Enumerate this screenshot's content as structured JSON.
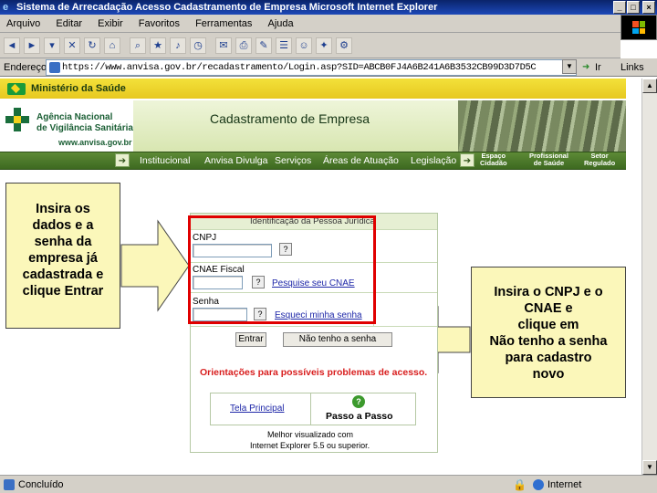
{
  "window": {
    "title": "Sistema de Arrecadação  Acesso  Cadastramento de Empresa  Microsoft Internet Explorer"
  },
  "menu": [
    "Arquivo",
    "Editar",
    "Exibir",
    "Favoritos",
    "Ferramentas",
    "Ajuda"
  ],
  "address": {
    "label": "Endereço",
    "url": "https://www.anvisa.gov.br/recadastramento/Login.asp?SID=ABCB0FJ4A6B241A6B3532CB99D3D7D5C",
    "go": "Ir",
    "links": "Links"
  },
  "header": {
    "ministry": "Ministério da Saúde",
    "agency_line1": "Agência Nacional",
    "agency_line2": "de Vigilância Sanitária",
    "agency_url": "www.anvisa.gov.br",
    "title": "Cadastramento de Empresa"
  },
  "nav": {
    "items": [
      "Institucional",
      "Anvisa Divulga",
      "Serviços",
      "Áreas de Atuação",
      "Legislação"
    ],
    "small": [
      {
        "line1": "Espaço",
        "line2": "Cidadão"
      },
      {
        "line1": "Profissional",
        "line2": "de Saúde"
      },
      {
        "line1": "Setor",
        "line2": "Regulado"
      }
    ]
  },
  "callouts": {
    "left": [
      "Insira os",
      "dados e a",
      "senha da",
      "empresa  já",
      "cadastrada e",
      "clique Entrar"
    ],
    "right": [
      "Insira o CNPJ e o",
      "CNAE e",
      "clique em",
      "Não tenho a senha",
      "para cadastro",
      "novo"
    ]
  },
  "form": {
    "header": "Identificação da Pessoa Jurídica",
    "cnpj_label": "CNPJ",
    "cnae_label": "CNAE Fiscal",
    "senha_label": "Senha",
    "help": "?",
    "search_cnae_link": "Pesquise seu CNAE",
    "forgot_link": "Esqueci minha senha",
    "enter_button": "Entrar",
    "no_password_button": "Não tenho a senha",
    "orientation": "Orientações para possíveis problemas de acesso.",
    "home_link": "Tela Principal",
    "step_icon": "?",
    "step_label": "Passo a Passo",
    "footer_line1": "Melhor visualizado com",
    "footer_line2": "Internet Explorer 5.5 ou superior."
  },
  "status": {
    "text": "Concluído",
    "zone": "Internet"
  },
  "colors": {
    "accent_red": "#e00000",
    "callout_bg": "#fbf7ba",
    "nav_green": "#4a7a2a",
    "ministry_yellow": "#ecd22a"
  }
}
